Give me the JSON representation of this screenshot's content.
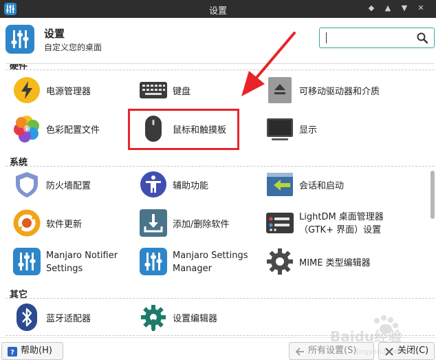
{
  "window": {
    "title": "设置",
    "controls": [
      "◆",
      "▲",
      "▼",
      "✕"
    ]
  },
  "header": {
    "title": "设置",
    "subtitle": "自定义您的桌面",
    "search_value": "",
    "search_icon": "search-icon"
  },
  "categories": {
    "hardware": {
      "label": "硬件"
    },
    "system": {
      "label": "系统"
    },
    "other": {
      "label": "其它"
    }
  },
  "items": {
    "power": "电源管理器",
    "keyboard": "键盘",
    "removable": "可移动驱动器和介质",
    "color": "色彩配置文件",
    "mouse": "鼠标和触摸板",
    "display": "显示",
    "firewall": "防火墙配置",
    "accessibility": "辅助功能",
    "session": "会话和启动",
    "updater": "软件更新",
    "addremove": "添加/删除软件",
    "lightdm_line1": "LightDM 桌面管理器",
    "lightdm_line2": "（GTK+ 界面）设置",
    "notifier_line1": "Manjaro Notifier",
    "notifier_line2": "Settings",
    "msm_line1": "Manjaro Settings",
    "msm_line2": "Manager",
    "mime": "MIME 类型编辑器",
    "bluetooth": "蓝牙适配器",
    "editor": "设置编辑器"
  },
  "footer": {
    "help": "帮助(H)",
    "all_settings": "所有设置(S)",
    "close": "关闭(C)"
  },
  "watermark": {
    "text": "Baidu经验",
    "subtext": "jingyan.baidu.com"
  },
  "colors": {
    "accent": "#2d86c9",
    "search_border": "#3aa39a",
    "annotation": "#e8242a",
    "titlebar": "#2e2e2e"
  }
}
